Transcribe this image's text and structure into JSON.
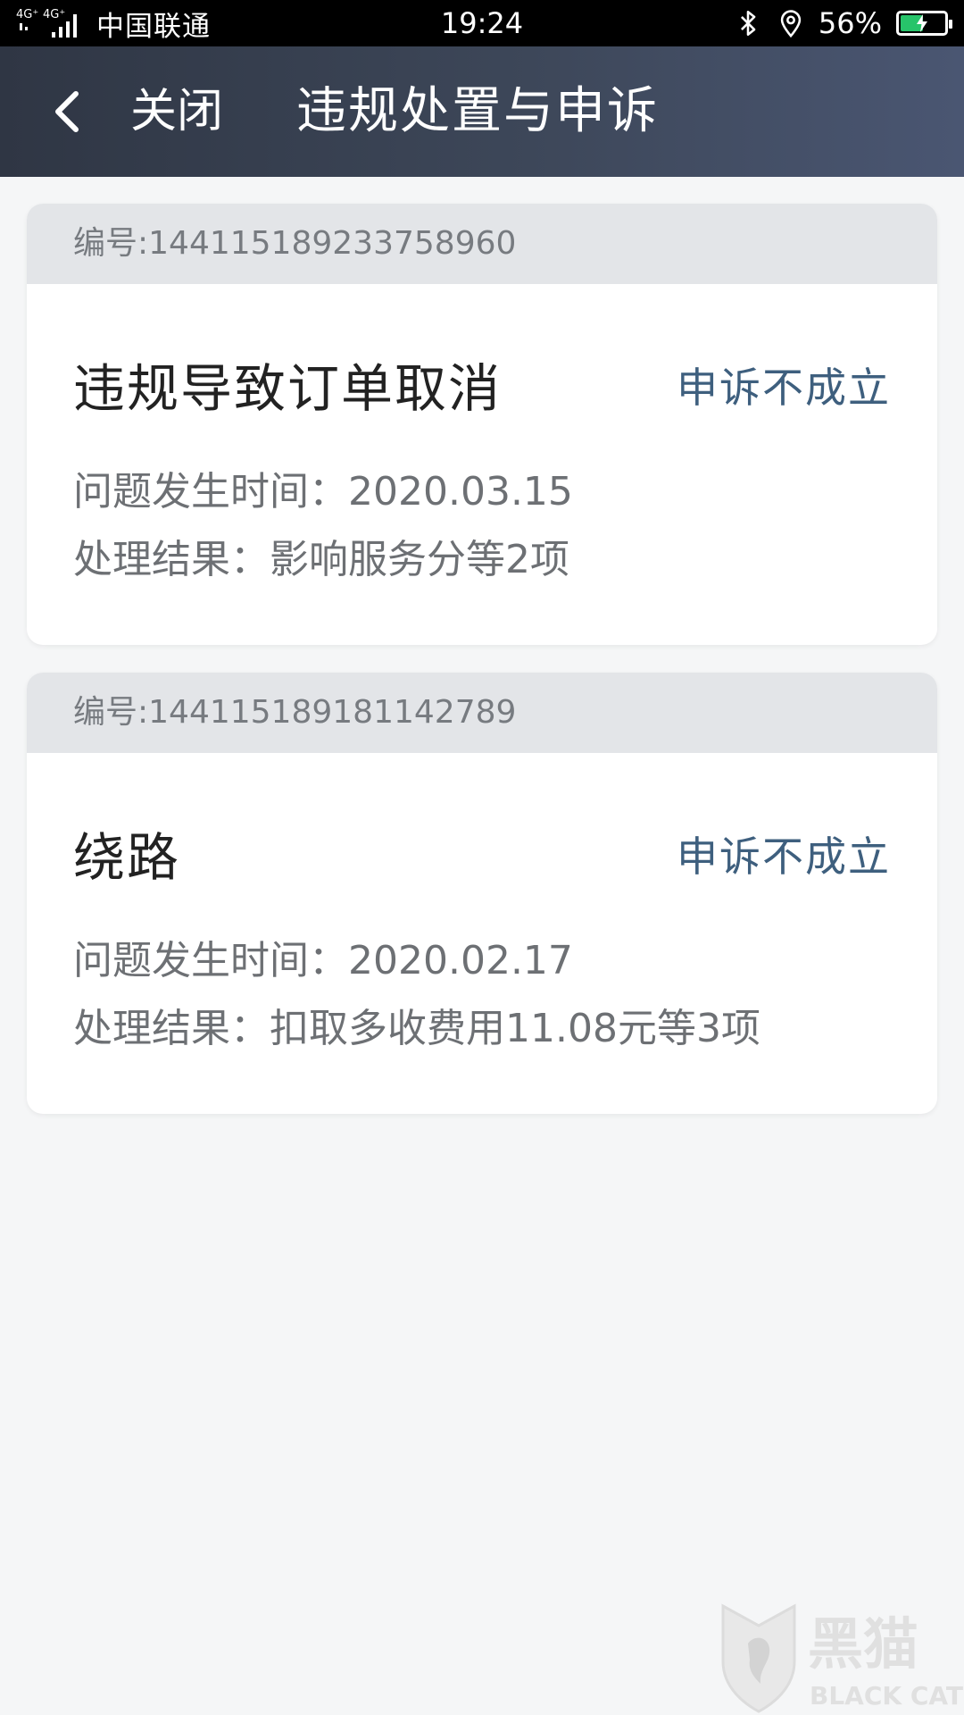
{
  "statusbar": {
    "network": "4G⁺ 4G⁺",
    "carrier": "中国联通",
    "time": "19:24",
    "battery_pct": "56%",
    "battery_level": 0.56,
    "battery_color": "#27c46a"
  },
  "navbar": {
    "back_icon": "chevron-left-icon",
    "close_label": "关闭",
    "title": "违规处置与申诉"
  },
  "cards": [
    {
      "id": "编号:1441151892337589​60",
      "title": "违规导致订单取消",
      "status": "申诉不成立",
      "time_line": "问题发生时间：2020.03.15",
      "result_line": "处理结果：影响服务分等2项"
    },
    {
      "id": "编号:144115189181142789",
      "title": "绕路",
      "status": "申诉不成立",
      "time_line": "问题发生时间：2020.02.17",
      "result_line": "处理结果：扣取多收费用11.08元等3项"
    }
  ],
  "watermark": {
    "text_cn": "黑猫",
    "text_en": "BLACK CAT"
  },
  "colors": {
    "status_text": "#3e5f7e",
    "navbar_start": "#2f3644",
    "navbar_end": "#4a5672",
    "background": "#f5f6f7"
  }
}
